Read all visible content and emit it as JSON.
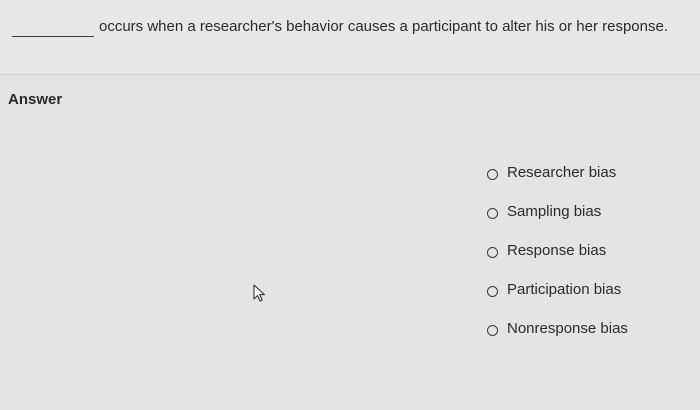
{
  "question": {
    "text": "occurs when a researcher's behavior causes a participant to alter his or her response."
  },
  "answer": {
    "label": "Answer",
    "options": [
      {
        "label": "Researcher bias"
      },
      {
        "label": "Sampling bias"
      },
      {
        "label": "Response bias"
      },
      {
        "label": "Participation bias"
      },
      {
        "label": "Nonresponse bias"
      }
    ]
  },
  "cursor": {
    "icon": "mouse-pointer-icon"
  }
}
